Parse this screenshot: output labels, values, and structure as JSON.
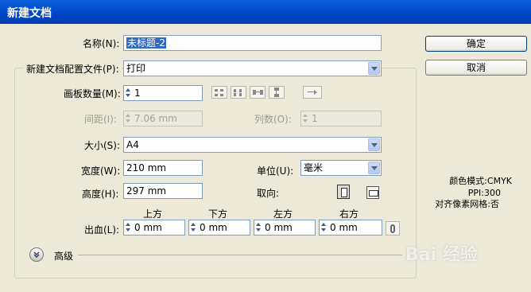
{
  "window": {
    "title": "新建文档"
  },
  "form": {
    "name_label": "名称(N):",
    "name_value": "未标题-2",
    "profile_label": "新建文档配置文件(P):",
    "profile_value": "打印",
    "artboards_label": "画板数量(M):",
    "artboards_value": "1",
    "spacing_label": "间距(I):",
    "spacing_value": "7.06 mm",
    "columns_label": "列数(O):",
    "columns_value": "1",
    "size_label": "大小(S):",
    "size_value": "A4",
    "width_label": "宽度(W):",
    "width_value": "210 mm",
    "unit_label": "单位(U):",
    "unit_value": "毫米",
    "height_label": "高度(H):",
    "height_value": "297 mm",
    "orientation_label": "取向:",
    "bleed_label": "出血(L):",
    "bleed_top_label": "上方",
    "bleed_bottom_label": "下方",
    "bleed_left_label": "左方",
    "bleed_right_label": "右方",
    "bleed_top": "0 mm",
    "bleed_bottom": "0 mm",
    "bleed_left": "0 mm",
    "bleed_right": "0 mm",
    "advanced_label": "高级"
  },
  "buttons": {
    "ok": "确定",
    "cancel": "取消"
  },
  "info": {
    "color_mode": "颜色模式:CMYK",
    "ppi": "PPI:300",
    "pixel_grid": "对齐像素网格:否"
  },
  "watermark": {
    "text": "Bai 经验"
  },
  "icons": [
    "grid-by-row-icon",
    "grid-by-column-icon",
    "arrange-by-row-icon",
    "arrange-by-column-icon",
    "right-to-left-icon",
    "portrait-icon",
    "landscape-icon",
    "link-icon",
    "expand-icon"
  ],
  "colors": {
    "titlebar": "#0046c8",
    "dialog": "#ece9d8",
    "selection": "#316ac5"
  }
}
